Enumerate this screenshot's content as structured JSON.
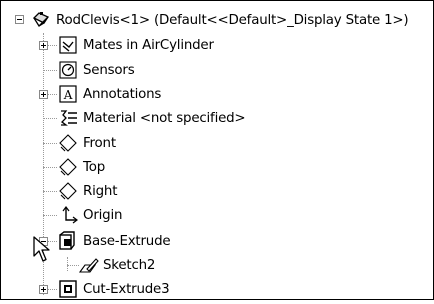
{
  "tree": {
    "root": "RodClevis<1> (Default<<Default>_Display State 1>)",
    "items": [
      {
        "label": "Mates in AirCylinder"
      },
      {
        "label": "Sensors"
      },
      {
        "label": "Annotations"
      },
      {
        "label": "Material <not specified>"
      },
      {
        "label": "Front"
      },
      {
        "label": "Top"
      },
      {
        "label": "Right"
      },
      {
        "label": "Origin"
      },
      {
        "label": "Base-Extrude"
      },
      {
        "label": "Sketch2"
      },
      {
        "label": "Cut-Extrude3"
      }
    ]
  }
}
